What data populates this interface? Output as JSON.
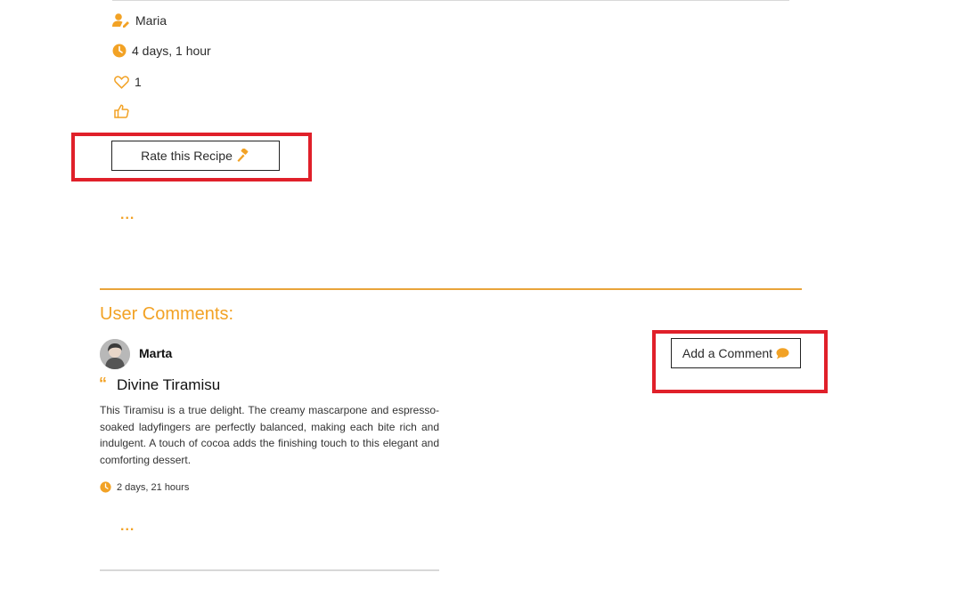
{
  "recipe_meta": {
    "author": "Maria",
    "author_icon": "user-edit-icon",
    "time_ago": "4 days, 1 hour",
    "time_icon": "clock-icon",
    "likes": "1",
    "likes_icon": "heart-outline-icon",
    "thumbs_icon": "thumbs-up-icon"
  },
  "rate_button": {
    "label": "Rate this Recipe",
    "icon": "gavel-icon"
  },
  "more_label": "...",
  "comments": {
    "heading": "User Comments:",
    "add_button": {
      "label": "Add a Comment",
      "icon": "comment-icon"
    },
    "items": [
      {
        "user": "Marta",
        "title": "Divine Tiramisu",
        "body": "This Tiramisu is a true delight. The creamy mascarpone and espresso-soaked ladyfingers are perfectly balanced, making each bite rich and indulgent. A touch of cocoa adds the finishing touch to this elegant and comforting dessert.",
        "time_ago": "2 days, 21 hours",
        "more_label": "..."
      }
    ]
  },
  "colors": {
    "accent": "#f2a225",
    "highlight": "#e0202a"
  }
}
